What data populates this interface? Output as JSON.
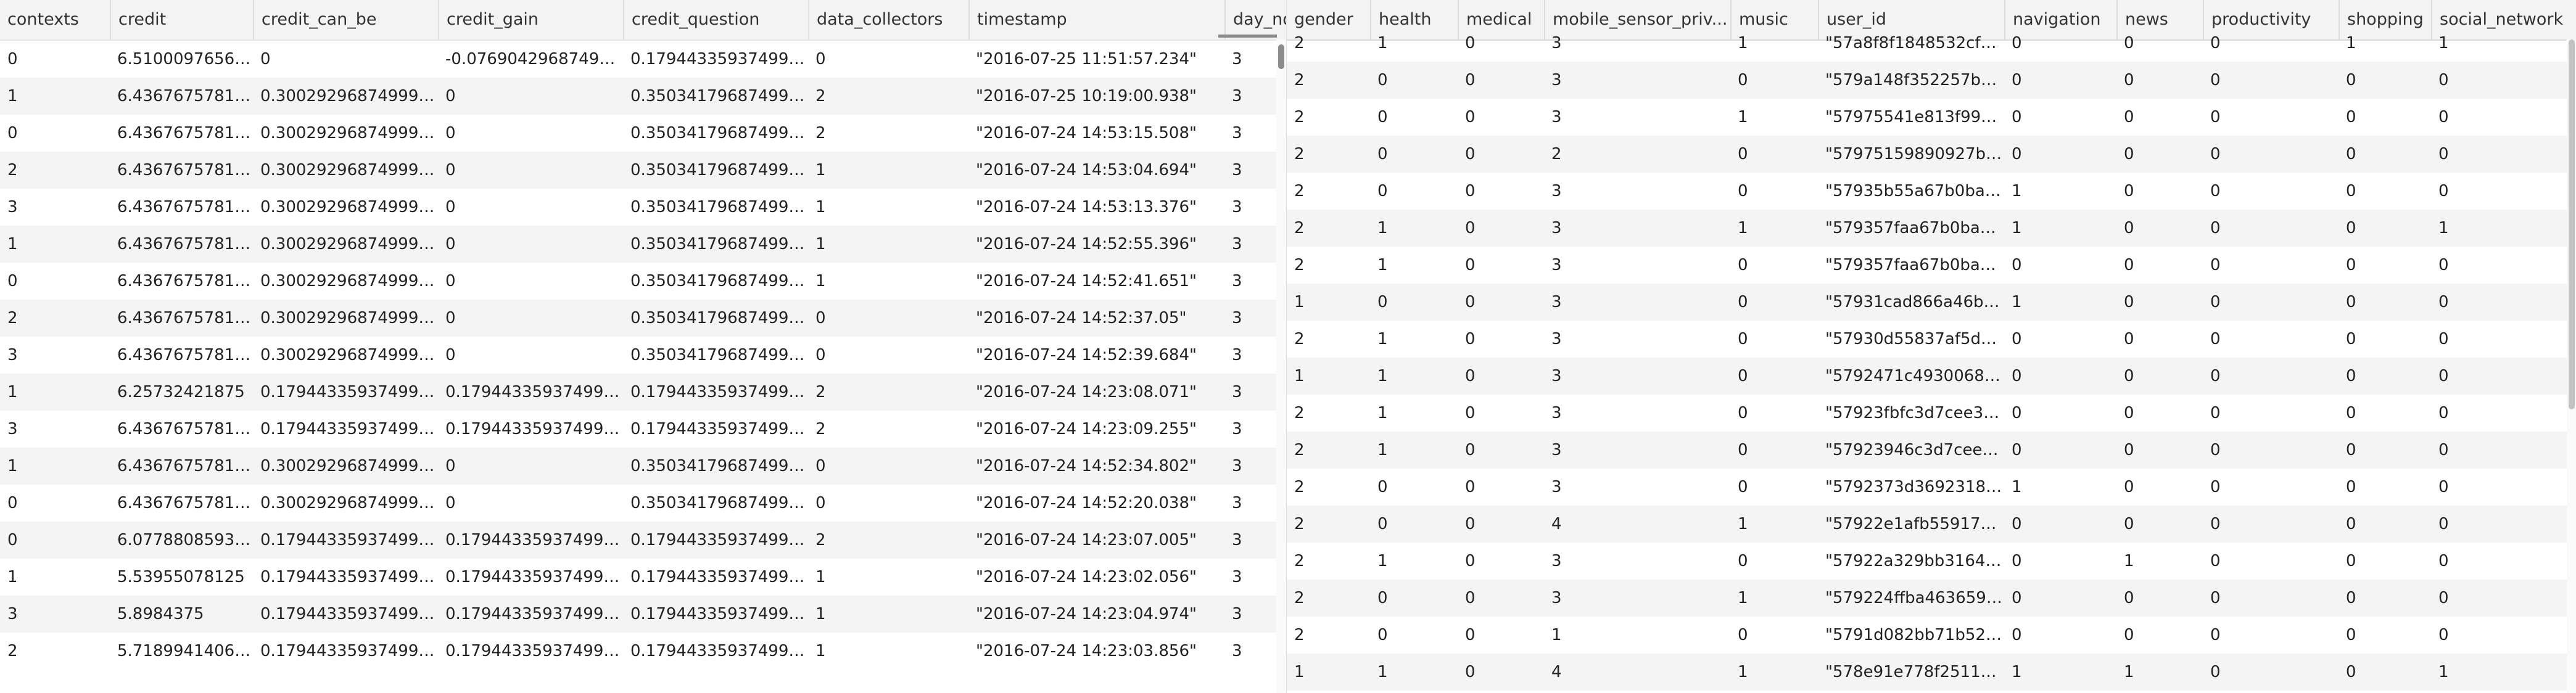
{
  "left_table": {
    "columns": [
      "contexts",
      "credit",
      "credit_can_be",
      "credit_gain",
      "credit_question",
      "data_collectors",
      "timestamp",
      "day_no"
    ],
    "rows": [
      [
        "0",
        "6.510009765625",
        "0",
        "-0.076904296874999...",
        "0.17944335937499994",
        "0",
        "\"2016-07-25 11:51:57.234\"",
        "3"
      ],
      [
        "1",
        "6.436767578125",
        "0.30029296874999994",
        "0",
        "0.35034179687499994",
        "2",
        "\"2016-07-25 10:19:00.938\"",
        "3"
      ],
      [
        "0",
        "6.436767578125",
        "0.30029296874999994",
        "0",
        "0.35034179687499994",
        "2",
        "\"2016-07-24 14:53:15.508\"",
        "3"
      ],
      [
        "2",
        "6.436767578125",
        "0.30029296874999994",
        "0",
        "0.35034179687499994",
        "1",
        "\"2016-07-24 14:53:04.694\"",
        "3"
      ],
      [
        "3",
        "6.436767578125",
        "0.30029296874999994",
        "0",
        "0.35034179687499994",
        "1",
        "\"2016-07-24 14:53:13.376\"",
        "3"
      ],
      [
        "1",
        "6.436767578125",
        "0.30029296874999994",
        "0",
        "0.35034179687499994",
        "1",
        "\"2016-07-24 14:52:55.396\"",
        "3"
      ],
      [
        "0",
        "6.436767578125",
        "0.30029296874999994",
        "0",
        "0.35034179687499994",
        "1",
        "\"2016-07-24 14:52:41.651\"",
        "3"
      ],
      [
        "2",
        "6.436767578125",
        "0.30029296874999994",
        "0",
        "0.35034179687499994",
        "0",
        "\"2016-07-24 14:52:37.05\"",
        "3"
      ],
      [
        "3",
        "6.436767578125",
        "0.30029296874999994",
        "0",
        "0.35034179687499994",
        "0",
        "\"2016-07-24 14:52:39.684\"",
        "3"
      ],
      [
        "1",
        "6.25732421875",
        "0.17944335937499994",
        "0.17944335937499994",
        "0.17944335937499994",
        "2",
        "\"2016-07-24 14:23:08.071\"",
        "3"
      ],
      [
        "3",
        "6.436767578125",
        "0.17944335937499994",
        "0.17944335937499994",
        "0.17944335937499994",
        "2",
        "\"2016-07-24 14:23:09.255\"",
        "3"
      ],
      [
        "1",
        "6.436767578125",
        "0.30029296874999994",
        "0",
        "0.35034179687499994",
        "0",
        "\"2016-07-24 14:52:34.802\"",
        "3"
      ],
      [
        "0",
        "6.436767578125",
        "0.30029296874999994",
        "0",
        "0.35034179687499994",
        "0",
        "\"2016-07-24 14:52:20.038\"",
        "3"
      ],
      [
        "0",
        "6.077880859375",
        "0.17944335937499994",
        "0.17944335937499994",
        "0.17944335937499994",
        "2",
        "\"2016-07-24 14:23:07.005\"",
        "3"
      ],
      [
        "1",
        "5.53955078125",
        "0.17944335937499994",
        "0.17944335937499994",
        "0.17944335937499994",
        "1",
        "\"2016-07-24 14:23:02.056\"",
        "3"
      ],
      [
        "3",
        "5.8984375",
        "0.17944335937499994",
        "0.17944335937499994",
        "0.17944335937499994",
        "1",
        "\"2016-07-24 14:23:04.974\"",
        "3"
      ],
      [
        "2",
        "5.718994140625",
        "0.17944335937499994",
        "0.17944335937499994",
        "0.17944335937499994",
        "1",
        "\"2016-07-24 14:23:03.856\"",
        "3"
      ]
    ]
  },
  "right_table": {
    "columns": [
      "gender",
      "health",
      "medical",
      "mobile_sensor_priv...",
      "music",
      "user_id",
      "navigation",
      "news",
      "productivity",
      "shopping",
      "social_network"
    ],
    "rows": [
      [
        "2",
        "1",
        "0",
        "3",
        "1",
        "\"57a8f8f1848532cf7...",
        "0",
        "0",
        "0",
        "1",
        "1"
      ],
      [
        "2",
        "0",
        "0",
        "3",
        "0",
        "\"579a148f352257bc0...",
        "0",
        "0",
        "0",
        "0",
        "0"
      ],
      [
        "2",
        "0",
        "0",
        "3",
        "1",
        "\"57975541e813f9973...",
        "0",
        "0",
        "0",
        "0",
        "0"
      ],
      [
        "2",
        "0",
        "0",
        "2",
        "0",
        "\"57975159890927b61...",
        "0",
        "0",
        "0",
        "0",
        "0"
      ],
      [
        "2",
        "0",
        "0",
        "3",
        "0",
        "\"57935b55a67b0ba32...",
        "1",
        "0",
        "0",
        "0",
        "0"
      ],
      [
        "2",
        "1",
        "0",
        "3",
        "1",
        "\"579357faa67b0ba32...",
        "1",
        "0",
        "0",
        "0",
        "1"
      ],
      [
        "2",
        "1",
        "0",
        "3",
        "0",
        "\"579357faa67b0ba32...",
        "0",
        "0",
        "0",
        "0",
        "0"
      ],
      [
        "1",
        "0",
        "0",
        "3",
        "0",
        "\"57931cad866a46bd5...",
        "1",
        "0",
        "0",
        "0",
        "0"
      ],
      [
        "2",
        "1",
        "0",
        "3",
        "0",
        "\"57930d55837af5db6...",
        "0",
        "0",
        "0",
        "0",
        "0"
      ],
      [
        "1",
        "1",
        "0",
        "3",
        "0",
        "\"5792471c493006891...",
        "0",
        "0",
        "0",
        "0",
        "0"
      ],
      [
        "2",
        "1",
        "0",
        "3",
        "0",
        "\"57923fbfc3d7cee30...",
        "0",
        "0",
        "0",
        "0",
        "0"
      ],
      [
        "2",
        "1",
        "0",
        "3",
        "0",
        "\"57923946c3d7cee30...",
        "0",
        "0",
        "0",
        "0",
        "0"
      ],
      [
        "2",
        "0",
        "0",
        "3",
        "0",
        "\"5792373d3692318e3...",
        "1",
        "0",
        "0",
        "0",
        "0"
      ],
      [
        "2",
        "0",
        "0",
        "4",
        "1",
        "\"57922e1afb5591741...",
        "0",
        "0",
        "0",
        "0",
        "0"
      ],
      [
        "2",
        "1",
        "0",
        "3",
        "0",
        "\"57922a329bb316492...",
        "0",
        "1",
        "0",
        "0",
        "0"
      ],
      [
        "2",
        "0",
        "0",
        "3",
        "1",
        "\"579224ffba4636590...",
        "0",
        "0",
        "0",
        "0",
        "0"
      ],
      [
        "2",
        "0",
        "0",
        "1",
        "0",
        "\"5791d082bb71b5202...",
        "0",
        "0",
        "0",
        "0",
        "0"
      ],
      [
        "1",
        "1",
        "0",
        "4",
        "1",
        "\"578e91e778f251171...",
        "1",
        "1",
        "0",
        "0",
        "1"
      ]
    ]
  }
}
